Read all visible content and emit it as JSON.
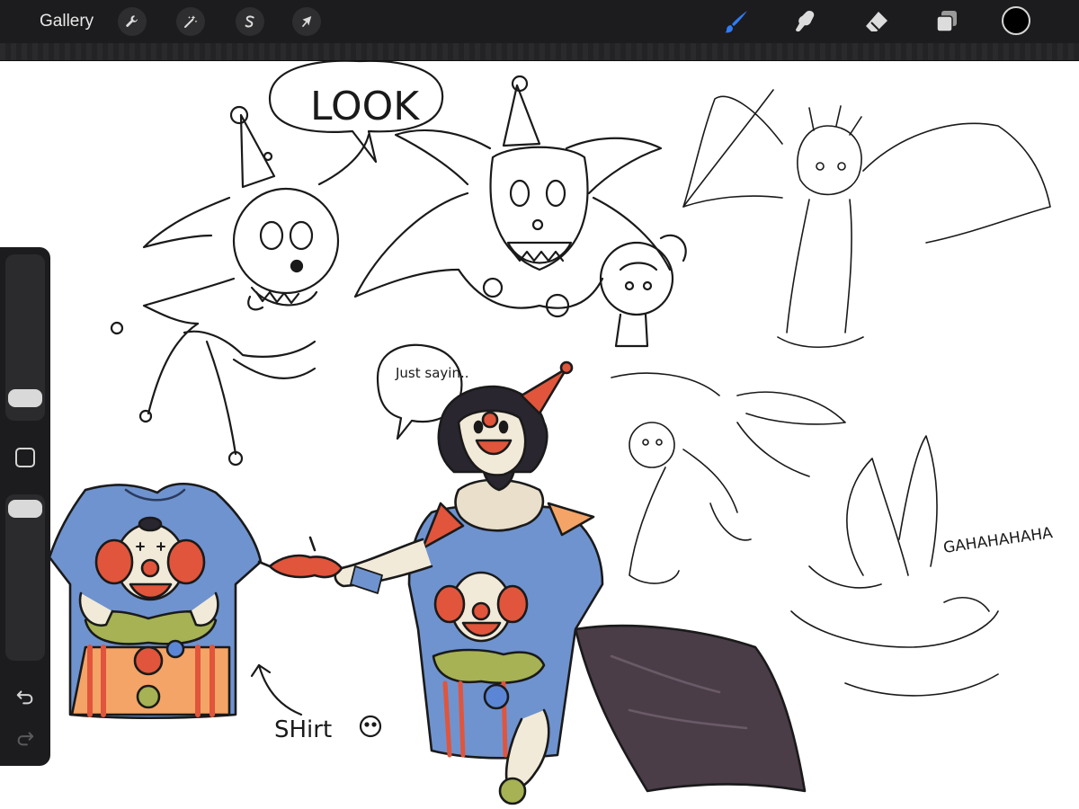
{
  "toolbar": {
    "gallery_label": "Gallery",
    "left_tools": [
      {
        "name": "actions",
        "icon": "wrench-icon"
      },
      {
        "name": "adjustments",
        "icon": "magic-wand-icon"
      },
      {
        "name": "selection",
        "icon": "selection-s-icon"
      },
      {
        "name": "transform",
        "icon": "arrow-cursor-icon"
      }
    ],
    "right_tools": [
      {
        "name": "brush",
        "icon": "brush-icon",
        "active": true
      },
      {
        "name": "smudge",
        "icon": "smudge-icon"
      },
      {
        "name": "eraser",
        "icon": "eraser-icon"
      },
      {
        "name": "layers",
        "icon": "layers-icon"
      }
    ],
    "current_color": "#000000",
    "active_color": "#2f7cf6"
  },
  "sidebar": {
    "size_slider_icon": "size-slider",
    "modify_icon": "square-icon",
    "opacity_slider_icon": "opacity-slider",
    "undo_icon": "undo-icon",
    "redo_icon": "redo-icon"
  },
  "canvas": {
    "texts": {
      "look": "LOOK",
      "just_sayin": "Just sayin..",
      "shirt": "SHirt",
      "laugh": "GAHAHAHAHA"
    },
    "colors": {
      "shirt_blue": "#6f93cf",
      "clown_red": "#e0553b",
      "clown_orange": "#f4a466",
      "ruff_green": "#a6b253",
      "wing_dark": "#4a3d48",
      "skin_cream": "#f2ead8",
      "hair_black": "#2a2630"
    }
  }
}
